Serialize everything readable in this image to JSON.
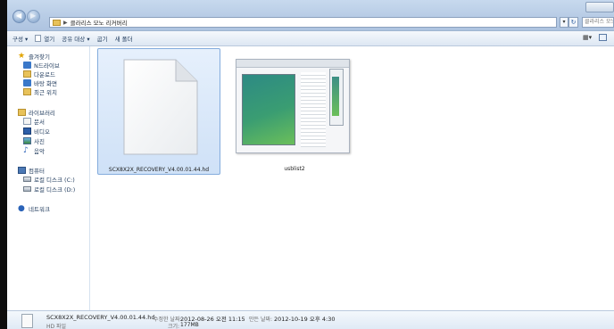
{
  "address": {
    "crumbs": [
      "클라리스 모노 리커버리"
    ],
    "search_placeholder": "클라리스 모노 리..."
  },
  "toolbar": {
    "organize": "구성 ▾",
    "open": "열기",
    "share": "공유 대상 ▾",
    "burn": "굽기",
    "new_folder": "새 폴더"
  },
  "nav": {
    "favorites": {
      "header": "즐겨찾기",
      "items": [
        "N드라이브",
        "다운로드",
        "바탕 화면",
        "최근 위치"
      ]
    },
    "libraries": {
      "header": "라이브러리",
      "items": [
        "문서",
        "비디오",
        "사진",
        "음악"
      ]
    },
    "computer": {
      "header": "컴퓨터",
      "items": [
        "로컬 디스크 (C:)",
        "로컬 디스크 (D:)"
      ]
    },
    "network": {
      "header": "네트워크"
    }
  },
  "files": [
    {
      "name": "SCX8X2X_RECOVERY_V4.00.01.44.hd",
      "icon": "blank-document-icon",
      "selected": true
    },
    {
      "name": "usblist2",
      "icon": "application-window-icon",
      "selected": false
    }
  ],
  "details": {
    "name": "SCX8X2X_RECOVERY_V4.00.01.44.hd",
    "type": "HD 파일",
    "modified_label": "수정한 날짜:",
    "modified_value": "2012-08-26 오전 11:15",
    "created_label": "만든 날짜:",
    "created_value": "2012-10-19 오후 4:30",
    "size_label": "크기:",
    "size_value": "177MB"
  },
  "colors": {
    "selection_fill": "#cfe1f7",
    "selection_border": "#84acdd",
    "chrome": "#b9cde6"
  }
}
